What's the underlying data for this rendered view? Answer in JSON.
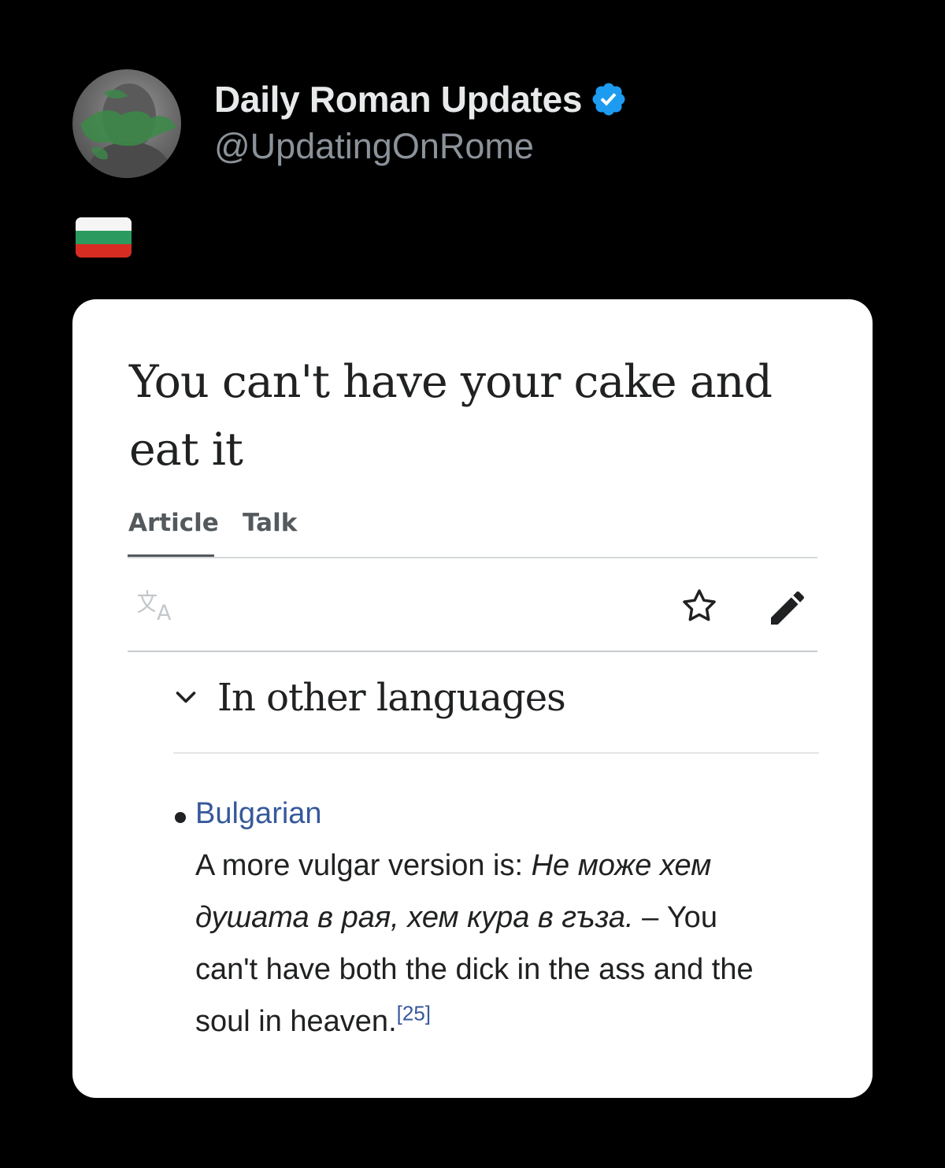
{
  "tweet": {
    "display_name": "Daily Roman Updates",
    "handle": "@UpdatingOnRome",
    "text_emoji": "🇧🇬",
    "verified_color": "#1d9bf0"
  },
  "wiki": {
    "title": "You can't have your cake and eat it",
    "tabs": [
      "Article",
      "Talk"
    ],
    "section_title": "In other languages",
    "language": "Bulgarian",
    "text_before": "A more vulgar version is: ",
    "text_italic": "Не може хем душата в рая, хем кура в гъза.",
    "text_after": " – You can't have both the dick in the ass and the soul in heaven.",
    "ref": "[25]",
    "link_color": "#36599b"
  }
}
